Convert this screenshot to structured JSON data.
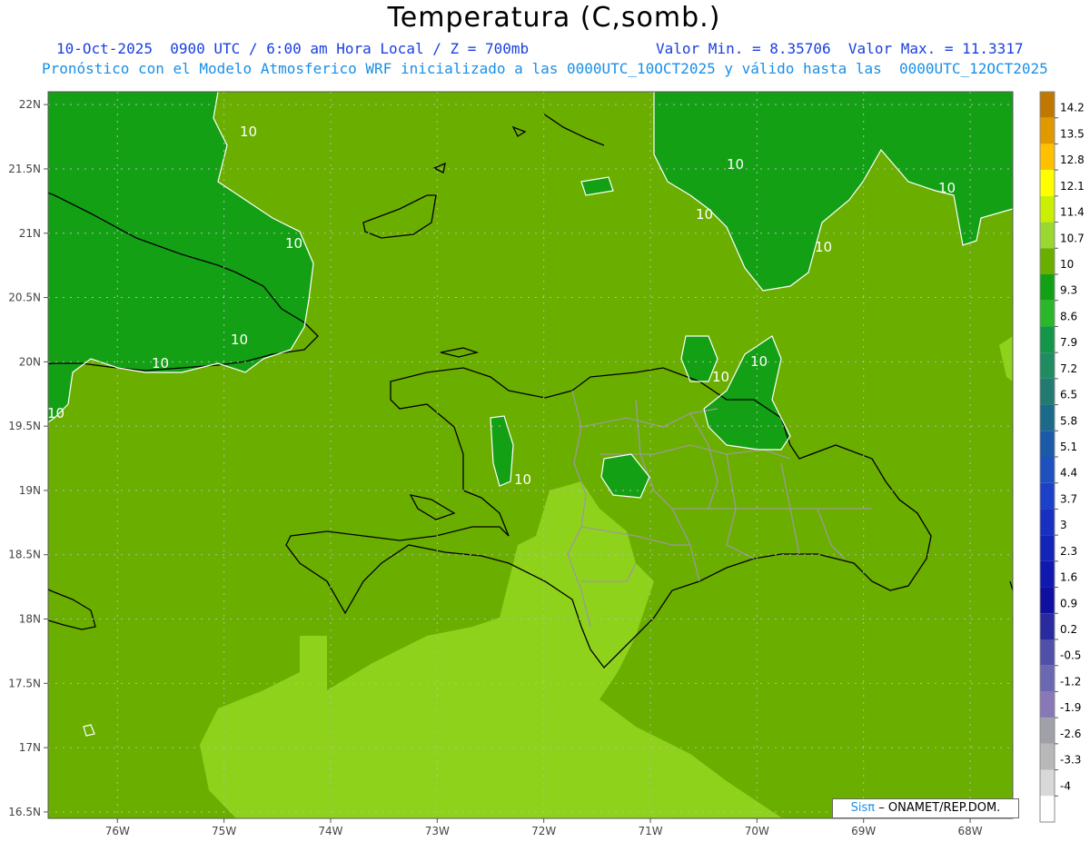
{
  "header": {
    "title": "Temperatura (C,somb.)",
    "line1": "10-Oct-2025  0900 UTC / 6:00 am Hora Local / Z = 700mb",
    "line1_right": "Valor Min. = 8.35706  Valor Max. = 11.3317",
    "line2": "Pronóstico con el Modelo Atmosferico WRF inicializado a las 0000UTC_10OCT2025 y válido hasta las  0000UTC_12OCT2025"
  },
  "axes": {
    "lat_labels": [
      "22N",
      "21.5N",
      "21N",
      "20.5N",
      "20N",
      "19.5N",
      "19N",
      "18.5N",
      "18N",
      "17.5N",
      "17N",
      "16.5N"
    ],
    "lon_labels": [
      "76W",
      "75W",
      "74W",
      "73W",
      "72W",
      "71W",
      "70W",
      "69W",
      "68W"
    ]
  },
  "colorbar": {
    "levels": [
      "14.2",
      "13.5",
      "12.8",
      "12.1",
      "11.4",
      "10.7",
      "10",
      "9.3",
      "8.6",
      "7.9",
      "7.2",
      "6.5",
      "5.8",
      "5.1",
      "4.4",
      "3.7",
      "3",
      "2.3",
      "1.6",
      "0.9",
      "0.2",
      "-0.5",
      "-1.2",
      "-1.9",
      "-2.6",
      "-3.3",
      "-4"
    ],
    "colors": [
      "#c07800",
      "#e09a00",
      "#ffc000",
      "#ffff00",
      "#c8f000",
      "#98d830",
      "#6aae00",
      "#14a014",
      "#2ab82a",
      "#14964a",
      "#1f8c62",
      "#227a70",
      "#1c6a8a",
      "#1a5aa8",
      "#1e50c0",
      "#1c40c8",
      "#1830c0",
      "#1424b8",
      "#1018b0",
      "#1010a0",
      "#2a2aa0",
      "#5050aa",
      "#6a68b0",
      "#8878b8",
      "#a0a0a8",
      "#b8b8b8",
      "#d8d8d8",
      "#ffffff"
    ]
  },
  "contour_label": "10",
  "fill_colors": {
    "base": "#6aae00",
    "cool": "#14a014",
    "warm": "#8fd21c"
  },
  "credit": {
    "brand": "Sisπ",
    "org": "– ONAMET/REP.DOM."
  }
}
